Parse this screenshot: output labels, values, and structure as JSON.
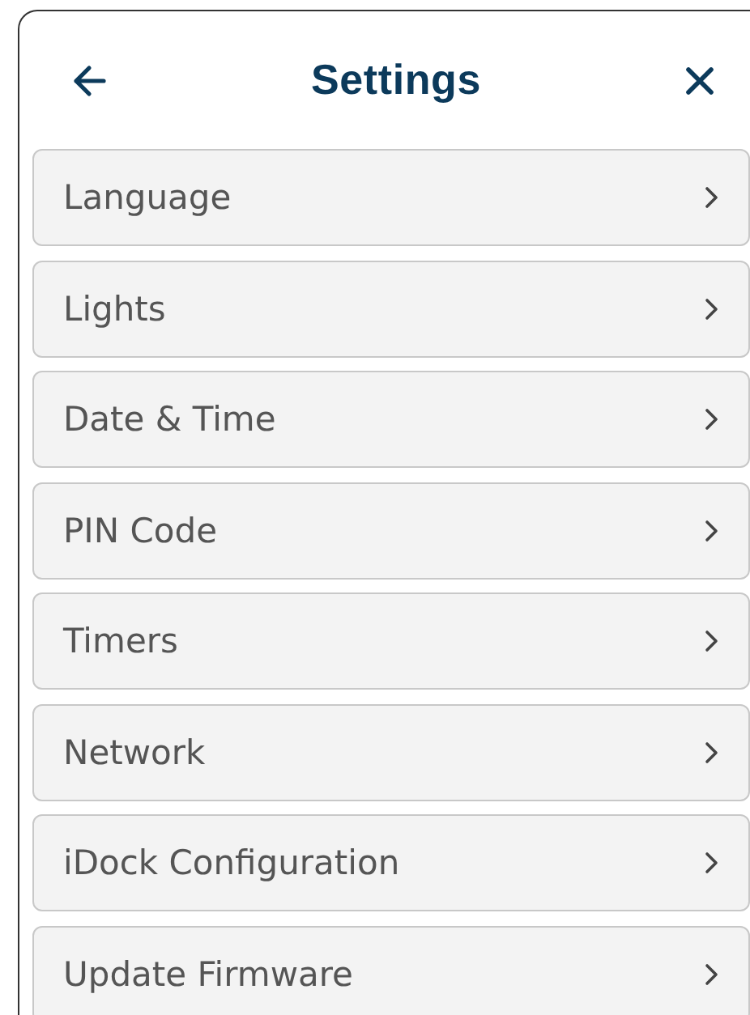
{
  "header": {
    "title": "Settings"
  },
  "items": [
    {
      "label": "Language"
    },
    {
      "label": "Lights"
    },
    {
      "label": "Date & Time"
    },
    {
      "label": "PIN Code"
    },
    {
      "label": "Timers"
    },
    {
      "label": "Network"
    },
    {
      "label": "iDock Configuration"
    },
    {
      "label": "Update Firmware"
    }
  ]
}
